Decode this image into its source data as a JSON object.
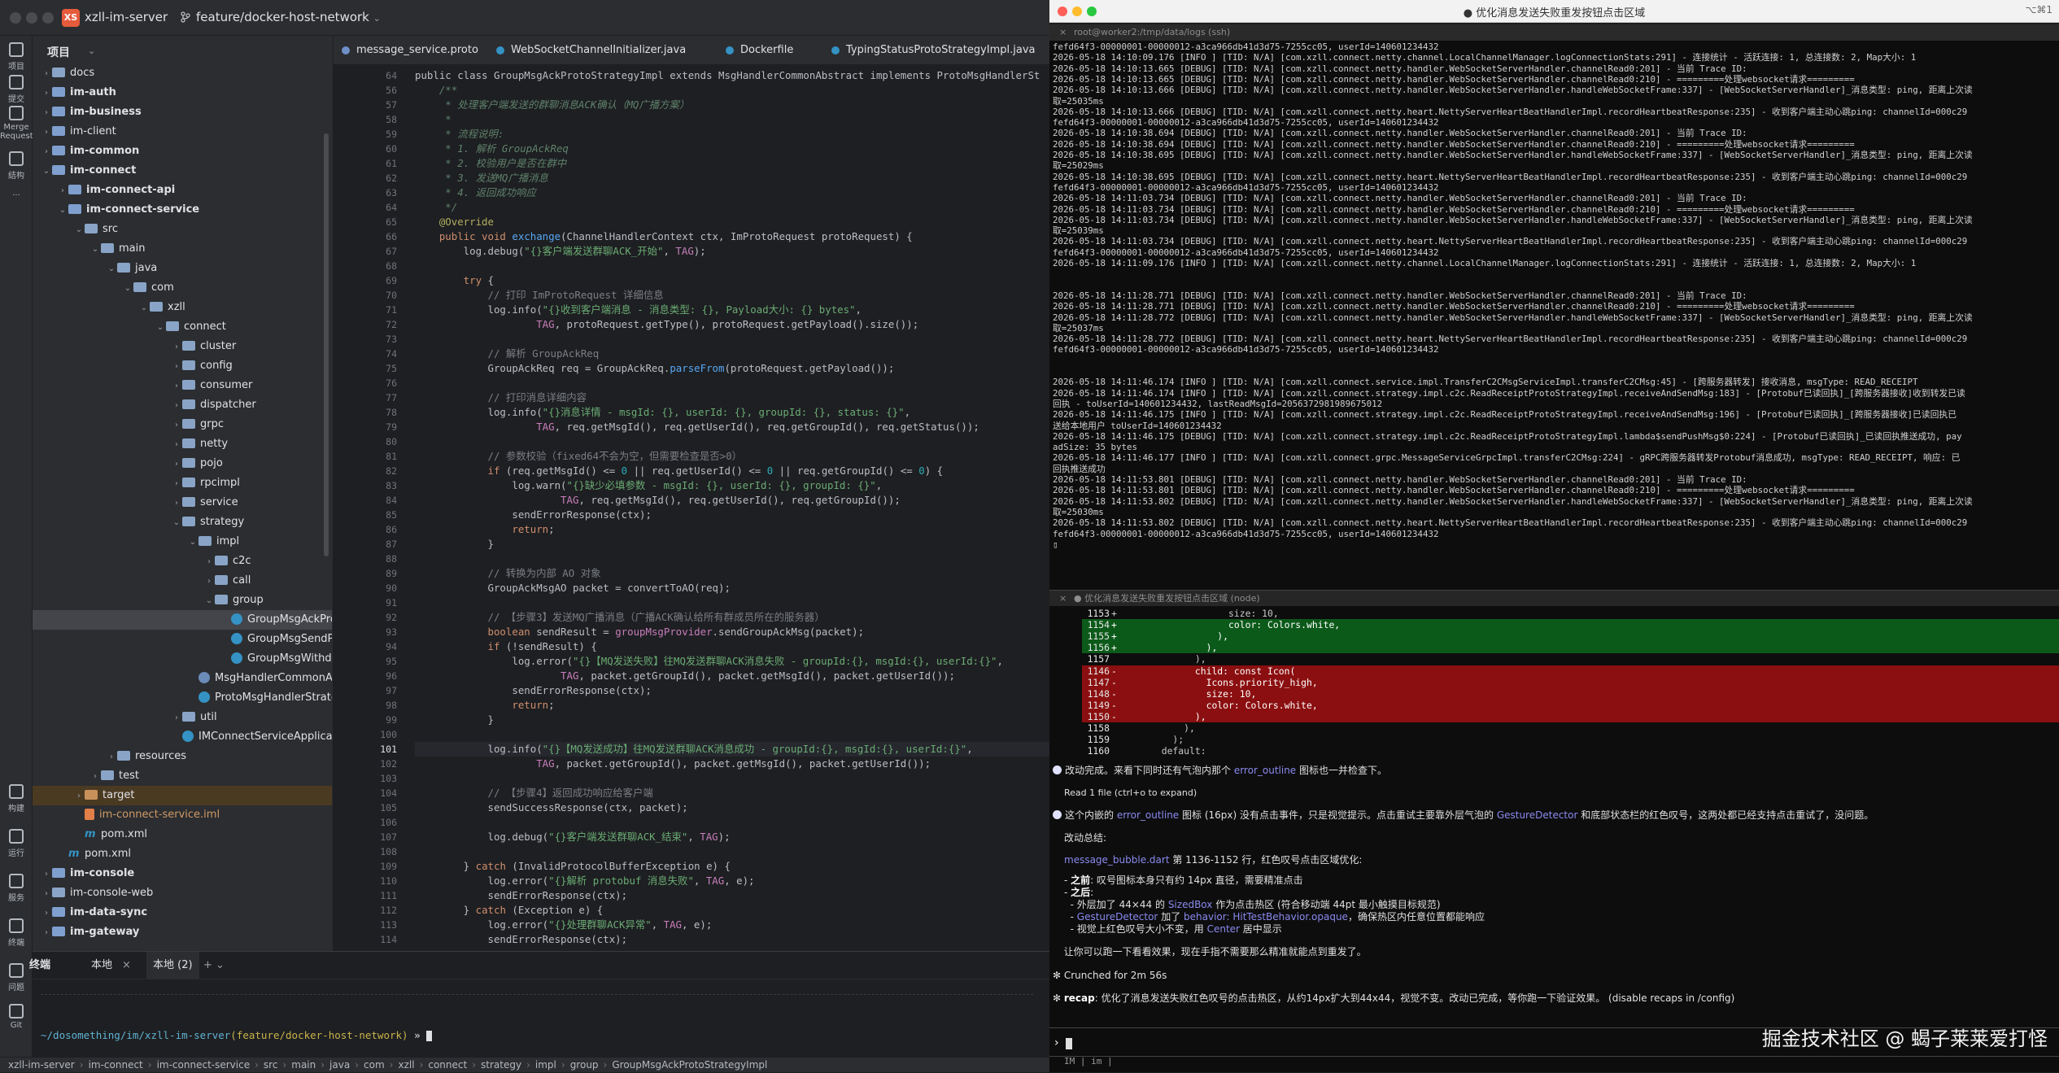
{
  "ide": {
    "project_badge": "XS",
    "project_name": "xzll-im-server",
    "branch": "feature/docker-host-network",
    "rail": [
      {
        "label": "项目"
      },
      {
        "label": "提交"
      },
      {
        "label": "Merge Requests"
      },
      {
        "label": "结构"
      },
      {
        "label": "..."
      }
    ],
    "rail_bottom": [
      {
        "label": "构建"
      },
      {
        "label": "运行"
      },
      {
        "label": "服务"
      },
      {
        "label": "终端"
      },
      {
        "label": "问题"
      },
      {
        "label": "Git"
      }
    ],
    "project_panel_title": "项目",
    "tree": [
      {
        "indent": 0,
        "arrow": "›",
        "icon": "folder",
        "name": "docs",
        "style": ""
      },
      {
        "indent": 0,
        "arrow": "›",
        "icon": "module",
        "name": "im-auth",
        "style": "bold"
      },
      {
        "indent": 0,
        "arrow": "›",
        "icon": "module",
        "name": "im-business",
        "style": "bold"
      },
      {
        "indent": 0,
        "arrow": "›",
        "icon": "module",
        "name": "im-client",
        "style": ""
      },
      {
        "indent": 0,
        "arrow": "›",
        "icon": "module",
        "name": "im-common",
        "style": "bold"
      },
      {
        "indent": 0,
        "arrow": "⌄",
        "icon": "module",
        "name": "im-connect",
        "style": "bold"
      },
      {
        "indent": 1,
        "arrow": "›",
        "icon": "module",
        "name": "im-connect-api",
        "style": "bold"
      },
      {
        "indent": 1,
        "arrow": "⌄",
        "icon": "module",
        "name": "im-connect-service",
        "style": "bold"
      },
      {
        "indent": 2,
        "arrow": "⌄",
        "icon": "folder",
        "name": "src",
        "style": ""
      },
      {
        "indent": 3,
        "arrow": "⌄",
        "icon": "folder",
        "name": "main",
        "style": ""
      },
      {
        "indent": 4,
        "arrow": "⌄",
        "icon": "folder",
        "name": "java",
        "style": ""
      },
      {
        "indent": 5,
        "arrow": "⌄",
        "icon": "folder",
        "name": "com",
        "style": ""
      },
      {
        "indent": 6,
        "arrow": "⌄",
        "icon": "folder",
        "name": "xzll",
        "style": ""
      },
      {
        "indent": 7,
        "arrow": "⌄",
        "icon": "folder",
        "name": "connect",
        "style": ""
      },
      {
        "indent": 8,
        "arrow": "›",
        "icon": "folder",
        "name": "cluster",
        "style": ""
      },
      {
        "indent": 8,
        "arrow": "›",
        "icon": "folder",
        "name": "config",
        "style": ""
      },
      {
        "indent": 8,
        "arrow": "›",
        "icon": "folder",
        "name": "consumer",
        "style": ""
      },
      {
        "indent": 8,
        "arrow": "›",
        "icon": "folder",
        "name": "dispatcher",
        "style": ""
      },
      {
        "indent": 8,
        "arrow": "›",
        "icon": "folder",
        "name": "grpc",
        "style": ""
      },
      {
        "indent": 8,
        "arrow": "›",
        "icon": "folder",
        "name": "netty",
        "style": ""
      },
      {
        "indent": 8,
        "arrow": "›",
        "icon": "folder",
        "name": "pojo",
        "style": ""
      },
      {
        "indent": 8,
        "arrow": "›",
        "icon": "folder",
        "name": "rpcimpl",
        "style": ""
      },
      {
        "indent": 8,
        "arrow": "›",
        "icon": "folder",
        "name": "service",
        "style": ""
      },
      {
        "indent": 8,
        "arrow": "⌄",
        "icon": "folder",
        "name": "strategy",
        "style": ""
      },
      {
        "indent": 9,
        "arrow": "⌄",
        "icon": "folder",
        "name": "impl",
        "style": ""
      },
      {
        "indent": 10,
        "arrow": "›",
        "icon": "folder",
        "name": "c2c",
        "style": ""
      },
      {
        "indent": 10,
        "arrow": "›",
        "icon": "folder",
        "name": "call",
        "style": ""
      },
      {
        "indent": 10,
        "arrow": "⌄",
        "icon": "folder",
        "name": "group",
        "style": ""
      },
      {
        "indent": 11,
        "arrow": "",
        "icon": "class",
        "name": "GroupMsgAckProtoStrategyImpl",
        "style": "selected"
      },
      {
        "indent": 11,
        "arrow": "",
        "icon": "class",
        "name": "GroupMsgSendProtoStrategyImpl",
        "style": ""
      },
      {
        "indent": 11,
        "arrow": "",
        "icon": "class",
        "name": "GroupMsgWithdrawProtoStrategyImpl",
        "style": ""
      },
      {
        "indent": 9,
        "arrow": "",
        "icon": "abstract",
        "name": "MsgHandlerCommonAbstract",
        "style": ""
      },
      {
        "indent": 9,
        "arrow": "",
        "icon": "class",
        "name": "ProtoMsgHandlerStrategy",
        "style": ""
      },
      {
        "indent": 8,
        "arrow": "›",
        "icon": "folder",
        "name": "util",
        "style": ""
      },
      {
        "indent": 8,
        "arrow": "",
        "icon": "class",
        "name": "IMConnectServiceApplication",
        "style": ""
      },
      {
        "indent": 4,
        "arrow": "›",
        "icon": "folder",
        "name": "resources",
        "style": ""
      },
      {
        "indent": 3,
        "arrow": "›",
        "icon": "folder",
        "name": "test",
        "style": ""
      },
      {
        "indent": 2,
        "arrow": "›",
        "icon": "orange",
        "name": "target",
        "style": "target"
      },
      {
        "indent": 2,
        "arrow": "",
        "icon": "xml",
        "name": "im-connect-service.iml",
        "style": "orange"
      },
      {
        "indent": 2,
        "arrow": "",
        "icon": "maven",
        "name": "pom.xml",
        "style": ""
      },
      {
        "indent": 1,
        "arrow": "",
        "icon": "maven",
        "name": "pom.xml",
        "style": ""
      },
      {
        "indent": 0,
        "arrow": "›",
        "icon": "module",
        "name": "im-console",
        "style": "bold"
      },
      {
        "indent": 0,
        "arrow": "›",
        "icon": "folder",
        "name": "im-console-web",
        "style": ""
      },
      {
        "indent": 0,
        "arrow": "›",
        "icon": "module",
        "name": "im-data-sync",
        "style": "bold"
      },
      {
        "indent": 0,
        "arrow": "›",
        "icon": "module",
        "name": "im-gateway",
        "style": "bold"
      }
    ],
    "tabs": [
      {
        "label": "message_service.proto",
        "color": "#6f8fc7"
      },
      {
        "label": "WebSocketChannelInitializer.java",
        "color": "#3592c4"
      },
      {
        "label": "Dockerfile",
        "color": "#3592c4"
      },
      {
        "label": "TypingStatusProtoStrategyImpl.java",
        "color": "#3592c4"
      }
    ],
    "class_header": "public class GroupMsgAckProtoStrategyImpl extends MsgHandlerCommonAbstract implements ProtoMsgHandlerSt",
    "line_numbers": [
      "64",
      "56",
      "57",
      "58",
      "59",
      "60",
      "61",
      "62",
      "63",
      "64",
      "65",
      "66",
      "67",
      "68",
      "69",
      "70",
      "71",
      "72",
      "73",
      "74",
      "75",
      "76",
      "77",
      "78",
      "79",
      "80",
      "81",
      "82",
      "83",
      "84",
      "85",
      "86",
      "87",
      "88",
      "89",
      "90",
      "91",
      "92",
      "93",
      "94",
      "95",
      "96",
      "97",
      "98",
      "99",
      "100",
      "101",
      "102",
      "103",
      "104",
      "105",
      "106",
      "107",
      "108",
      "109",
      "110",
      "111",
      "112",
      "113",
      "114"
    ],
    "current_line": "101",
    "terminal_tabs": [
      "终端",
      "本地",
      "本地 (2)"
    ],
    "terminal_prompt_path": "~/dosomething/im/xzll-im-server",
    "terminal_prompt_branch": "(feature/docker-host-network)",
    "terminal_prompt_tail": " » ",
    "status_path": [
      "xzll-im-server",
      "im-connect",
      "im-connect-service",
      "src",
      "main",
      "java",
      "com",
      "xzll",
      "connect",
      "strategy",
      "impl",
      "group",
      "GroupMsgAckProtoStrategyImpl"
    ]
  },
  "terminal": {
    "window_title": "● 优化消息发送失败重发按钮点击区域",
    "shortcut": "⌥⌘1",
    "ssh_tab": "root@worker2:/tmp/data/logs (ssh)",
    "node_tab": "● 优化消息发送失败重发按钮点击区域 (node)",
    "watermark": "掘金技术社区 @ 蝎子莱莱爱打怪",
    "status_bar": "IM | im |"
  },
  "log_lines": [
    "fefd64f3-00000001-00000012-a3ca966db41d3d75-7255cc05, userId=140601234432",
    "2026-05-18 14:10:09.176 [INFO ] [TID: N/A] [com.xzll.connect.netty.channel.LocalChannelManager.logConnectionStats:291] - 连接统计 - 活跃连接: 1, 总连接数: 2, Map大小: 1",
    "2026-05-18 14:10:13.665 [DEBUG] [TID: N/A] [com.xzll.connect.netty.handler.WebSocketServerHandler.channelRead0:201] - 当前 Trace ID:",
    "2026-05-18 14:10:13.665 [DEBUG] [TID: N/A] [com.xzll.connect.netty.handler.WebSocketServerHandler.channelRead0:210] - =========处理websocket请求=========",
    "2026-05-18 14:10:13.666 [DEBUG] [TID: N/A] [com.xzll.connect.netty.handler.WebSocketServerHandler.handleWebSocketFrame:337] - [WebSocketServerHandler]_消息类型: ping, 距离上次读",
    "取=25035ms",
    "2026-05-18 14:10:13.666 [DEBUG] [TID: N/A] [com.xzll.connect.netty.heart.NettyServerHeartBeatHandlerImpl.recordHeartbeatResponse:235] - 收到客户端主动心跳ping: channelId=000c29",
    "fefd64f3-00000001-00000012-a3ca966db41d3d75-7255cc05, userId=140601234432",
    "2026-05-18 14:10:38.694 [DEBUG] [TID: N/A] [com.xzll.connect.netty.handler.WebSocketServerHandler.channelRead0:201] - 当前 Trace ID:",
    "2026-05-18 14:10:38.694 [DEBUG] [TID: N/A] [com.xzll.connect.netty.handler.WebSocketServerHandler.channelRead0:210] - =========处理websocket请求=========",
    "2026-05-18 14:10:38.695 [DEBUG] [TID: N/A] [com.xzll.connect.netty.handler.WebSocketServerHandler.handleWebSocketFrame:337] - [WebSocketServerHandler]_消息类型: ping, 距离上次读",
    "取=25029ms",
    "2026-05-18 14:10:38.695 [DEBUG] [TID: N/A] [com.xzll.connect.netty.heart.NettyServerHeartBeatHandlerImpl.recordHeartbeatResponse:235] - 收到客户端主动心跳ping: channelId=000c29",
    "fefd64f3-00000001-00000012-a3ca966db41d3d75-7255cc05, userId=140601234432",
    "2026-05-18 14:11:03.734 [DEBUG] [TID: N/A] [com.xzll.connect.netty.handler.WebSocketServerHandler.channelRead0:201] - 当前 Trace ID:",
    "2026-05-18 14:11:03.734 [DEBUG] [TID: N/A] [com.xzll.connect.netty.handler.WebSocketServerHandler.channelRead0:210] - =========处理websocket请求=========",
    "2026-05-18 14:11:03.734 [DEBUG] [TID: N/A] [com.xzll.connect.netty.handler.WebSocketServerHandler.handleWebSocketFrame:337] - [WebSocketServerHandler]_消息类型: ping, 距离上次读",
    "取=25039ms",
    "2026-05-18 14:11:03.734 [DEBUG] [TID: N/A] [com.xzll.connect.netty.heart.NettyServerHeartBeatHandlerImpl.recordHeartbeatResponse:235] - 收到客户端主动心跳ping: channelId=000c29",
    "fefd64f3-00000001-00000012-a3ca966db41d3d75-7255cc05, userId=140601234432",
    "2026-05-18 14:11:09.176 [INFO ] [TID: N/A] [com.xzll.connect.netty.channel.LocalChannelManager.logConnectionStats:291] - 连接统计 - 活跃连接: 1, 总连接数: 2, Map大小: 1",
    "",
    "",
    "2026-05-18 14:11:28.771 [DEBUG] [TID: N/A] [com.xzll.connect.netty.handler.WebSocketServerHandler.channelRead0:201] - 当前 Trace ID:",
    "2026-05-18 14:11:28.771 [DEBUG] [TID: N/A] [com.xzll.connect.netty.handler.WebSocketServerHandler.channelRead0:210] - =========处理websocket请求=========",
    "2026-05-18 14:11:28.772 [DEBUG] [TID: N/A] [com.xzll.connect.netty.handler.WebSocketServerHandler.handleWebSocketFrame:337] - [WebSocketServerHandler]_消息类型: ping, 距离上次读",
    "取=25037ms",
    "2026-05-18 14:11:28.772 [DEBUG] [TID: N/A] [com.xzll.connect.netty.heart.NettyServerHeartBeatHandlerImpl.recordHeartbeatResponse:235] - 收到客户端主动心跳ping: channelId=000c29",
    "fefd64f3-00000001-00000012-a3ca966db41d3d75-7255cc05, userId=140601234432",
    "",
    "",
    "2026-05-18 14:11:46.174 [INFO ] [TID: N/A] [com.xzll.connect.service.impl.TransferC2CMsgServiceImpl.transferC2CMsg:45] - [跨服务器转发] 接收消息, msgType: READ_RECEIPT",
    "2026-05-18 14:11:46.174 [INFO ] [TID: N/A] [com.xzll.connect.strategy.impl.c2c.ReadReceiptProtoStrategyImpl.receiveAndSendMsg:183] - [Protobuf已读回执]_[跨服务器接收]收到转发已读",
    "回执 - toUserId=140601234432, lastReadMsgId=2056372981989675012",
    "2026-05-18 14:11:46.175 [INFO ] [TID: N/A] [com.xzll.connect.strategy.impl.c2c.ReadReceiptProtoStrategyImpl.receiveAndSendMsg:196] - [Protobuf已读回执]_[跨服务器接收]已读回执已",
    "送给本地用户 toUserId=140601234432",
    "2026-05-18 14:11:46.175 [DEBUG] [TID: N/A] [com.xzll.connect.strategy.impl.c2c.ReadReceiptProtoStrategyImpl.lambda$sendPushMsg$0:224] - [Protobuf已读回执]_已读回执推送成功, pay",
    "adSize: 35 bytes",
    "2026-05-18 14:11:46.177 [INFO ] [TID: N/A] [com.xzll.connect.grpc.MessageServiceGrpcImpl.transferC2CMsg:224] - gRPC跨服务器转发Protobuf消息成功, msgType: READ_RECEIPT, 响应: 已",
    "回执推送成功",
    "2026-05-18 14:11:53.801 [DEBUG] [TID: N/A] [com.xzll.connect.netty.handler.WebSocketServerHandler.channelRead0:201] - 当前 Trace ID:",
    "2026-05-18 14:11:53.801 [DEBUG] [TID: N/A] [com.xzll.connect.netty.handler.WebSocketServerHandler.channelRead0:210] - =========处理websocket请求=========",
    "2026-05-18 14:11:53.802 [DEBUG] [TID: N/A] [com.xzll.connect.netty.handler.WebSocketServerHandler.handleWebSocketFrame:337] - [WebSocketServerHandler]_消息类型: ping, 距离上次读",
    "取=25030ms",
    "2026-05-18 14:11:53.802 [DEBUG] [TID: N/A] [com.xzll.connect.netty.heart.NettyServerHeartBeatHandlerImpl.recordHeartbeatResponse:235] - 收到客户端主动心跳ping: channelId=000c29",
    "fefd64f3-00000001-00000012-a3ca966db41d3d75-7255cc05, userId=140601234432",
    "▯"
  ],
  "diff": [
    {
      "t": "ctx",
      "n": "1153",
      "s": "+",
      "txt": "                    size: 10,"
    },
    {
      "t": "add",
      "n": "1154",
      "s": "+",
      "txt": "                    color: Colors.white,"
    },
    {
      "t": "add",
      "n": "1155",
      "s": "+",
      "txt": "                  ),"
    },
    {
      "t": "add",
      "n": "1156",
      "s": "+",
      "txt": "                ),"
    },
    {
      "t": "ctx",
      "n": "1157",
      "s": " ",
      "txt": "              ),"
    },
    {
      "t": "del",
      "n": "1146",
      "s": "-",
      "txt": "              child: const Icon("
    },
    {
      "t": "del",
      "n": "1147",
      "s": "-",
      "txt": "                Icons.priority_high,"
    },
    {
      "t": "del",
      "n": "1148",
      "s": "-",
      "txt": "                size: 10,"
    },
    {
      "t": "del",
      "n": "1149",
      "s": "-",
      "txt": "                color: Colors.white,"
    },
    {
      "t": "del",
      "n": "1150",
      "s": "-",
      "txt": "              ),"
    },
    {
      "t": "ctx",
      "n": "1158",
      "s": " ",
      "txt": "            ),"
    },
    {
      "t": "ctx",
      "n": "1159",
      "s": " ",
      "txt": "          );"
    },
    {
      "t": "ctx",
      "n": "1160",
      "s": " ",
      "txt": "        default:"
    }
  ],
  "claude": {
    "msg1_a": "改动完成。来看下同时还有气泡内那个 ",
    "msg1_hl": "error_outline",
    "msg1_b": " 图标也一并检查下。",
    "read_note": "Read 1 file (ctrl+o to expand)",
    "msg2_a": "这个内嵌的 ",
    "msg2_hl1": "error_outline",
    "msg2_b": " 图标 (16px) 没有点击事件，只是视觉提示。点击重试主要靠外层气泡的 ",
    "msg2_hl2": "GestureDetector",
    "msg2_c": " 和底部状态栏的红色叹号，这两处都已经支持点击重试了，没问题。",
    "summary_title": "改动总结:",
    "summary_file_hl": "message_bubble.dart",
    "summary_file_rest": " 第 1136-1152 行，红色叹号点击区域优化:",
    "before_label": "之前",
    "before_text": ": 叹号图标本身只有约 14px 直径，需要精准点击",
    "after_label": "之后",
    "after_suffix": ":",
    "after_1a": "  - 外层加了 44×44 的 ",
    "after_1hl": "SizedBox",
    "after_1b": " 作为点击热区 (符合移动端 44pt 最小触摸目标规范)",
    "after_2hl": "GestureDetector",
    "after_2a": " 加了 ",
    "after_2hl2": "behavior: HitTestBehavior.opaque",
    "after_2b": "，确保热区内任意位置都能响应",
    "after_3a": "  - 视觉上红色叹号大小不变，用 ",
    "after_3hl": "Center",
    "after_3b": " 居中显示",
    "closing": "  让你可以跑一下看看效果，现在手指不需要那么精准就能点到重发了。",
    "crunched": "✻ Crunched for 2m 56s",
    "recap_label": "recap",
    "recap_text": ": 优化了消息发送失败红色叹号的点击热区，从约14px扩大到44x44，视觉不变。改动已完成，等你跑一下验证效果。 (disable recaps in /config)"
  }
}
